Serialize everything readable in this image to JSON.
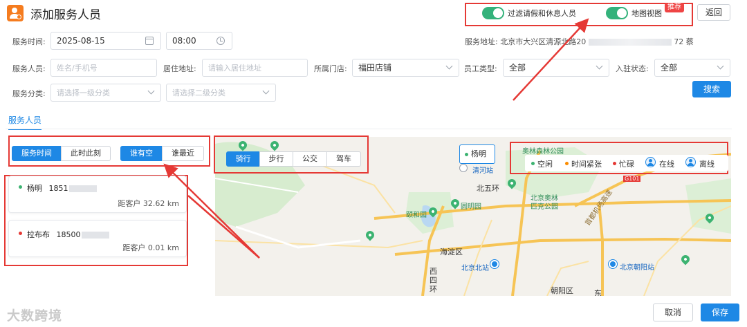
{
  "header": {
    "title": "添加服务人员",
    "toggle_leave": "过滤请假和休息人员",
    "toggle_map": "地图视图",
    "recommend_tag": "推荐",
    "back_label": "返回"
  },
  "form": {
    "service_time_label": "服务时间:",
    "service_date": "2025-08-15",
    "service_time": "08:00",
    "address_label": "服务地址:",
    "address_value": "北京市大兴区清源北路20",
    "address_tail": "72  蔡",
    "staff_label": "服务人员:",
    "staff_placeholder": "姓名/手机号",
    "residence_label": "居住地址:",
    "residence_placeholder": "请输入居住地址",
    "store_label": "所属门店:",
    "store_value": "福田店铺",
    "emp_type_label": "员工类型:",
    "emp_type_value": "全部",
    "status_label": "入驻状态:",
    "status_value": "全部",
    "category_label": "服务分类:",
    "category1_placeholder": "请选择一级分类",
    "category2_placeholder": "请选择二级分类",
    "search_label": "搜索"
  },
  "tabs": {
    "staff": "服务人员"
  },
  "filters": {
    "service_time": "服务时间",
    "right_now": "此时此刻",
    "who_free": "谁有空",
    "who_nearest": "谁最近"
  },
  "staff_list": [
    {
      "name": "杨明",
      "phone": "1851",
      "distance": "距客户 32.62 km",
      "status_color": "#3cb371"
    },
    {
      "name": "拉布布",
      "phone": "18500",
      "distance": "距客户 0.01 km",
      "status_color": "#e53935"
    }
  ],
  "transit": {
    "ride": "骑行",
    "walk": "步行",
    "bus": "公交",
    "drive": "驾车"
  },
  "map": {
    "marker_name": "杨明",
    "labels": {
      "north_forest": "奥林森林公园",
      "qinghe": "清河站",
      "north_5th_ring": "北五环",
      "olympic": "北京奥林",
      "olympic2": "匹克公园",
      "summer_palace": "颐和园",
      "yuanmingyuan": "圆明园",
      "haidian": "海淀区",
      "bj_north": "北京北站",
      "xisihuan": "西",
      "xisihuan2": "四",
      "xisihuan3": "环",
      "chaoyang": "朝阳区",
      "bj_chaoyang_station": "北京朝阳站",
      "dong": "东",
      "g101": "G101",
      "airport": "首都机场高速"
    },
    "legend": {
      "idle": "空闲",
      "tight": "时间紧张",
      "busy": "忙碌",
      "online": "在线",
      "offline": "离线",
      "idle_color": "#3cb371",
      "tight_color": "#fb8c00",
      "busy_color": "#e53935"
    }
  },
  "footer": {
    "watermark": "大数跨境",
    "cancel_label": "取消",
    "save_label": "保存"
  }
}
